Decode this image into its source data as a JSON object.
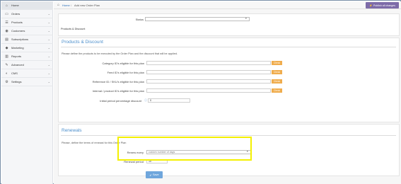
{
  "sidebar": {
    "items": [
      {
        "icon": "home-icon",
        "glyph": "⌂",
        "label": "Home",
        "has_chevron": false
      },
      {
        "icon": "cart-icon",
        "glyph": "🛒",
        "label": "Orders",
        "has_chevron": true
      },
      {
        "icon": "list-icon",
        "glyph": "☰",
        "label": "Products",
        "has_chevron": true
      },
      {
        "icon": "users-icon",
        "glyph": "👥",
        "label": "Customers",
        "has_chevron": true
      },
      {
        "icon": "subscriptions-icon",
        "glyph": "▤",
        "label": "Subscriptions",
        "has_chevron": true
      },
      {
        "icon": "tag-icon",
        "glyph": "🏷",
        "label": "Marketing",
        "has_chevron": true
      },
      {
        "icon": "chart-icon",
        "glyph": "▥",
        "label": "Reports",
        "has_chevron": true
      },
      {
        "icon": "wrench-icon",
        "glyph": "🔧",
        "label": "Advanced",
        "has_chevron": true
      },
      {
        "icon": "cms-icon",
        "glyph": "◐",
        "label": "CMS",
        "has_chevron": true
      },
      {
        "icon": "gear-icon",
        "glyph": "⚙",
        "label": "Settings",
        "has_chevron": true
      }
    ]
  },
  "breadcrumb": {
    "home": "Home",
    "separator": "/",
    "current": "Add new Order Plan"
  },
  "publish_button": {
    "label": "Publish all changes",
    "icon": "bolt-icon",
    "glyph": "⚡"
  },
  "status": {
    "label": "Status",
    "value": ""
  },
  "products_discount_small": "Products & Discount",
  "products_section": {
    "heading": "Products & Discount",
    "description": "Please define the products to be executed by the Order Plan and the discount that will be applied.",
    "fields": [
      {
        "label": "Category ID's eligible for this plan",
        "value": "",
        "button": "Check"
      },
      {
        "label": "Feed ID's eligible for this plan",
        "value": "",
        "button": "Check"
      },
      {
        "label": "Reference ID / SKU's eligible for this plan",
        "value": "",
        "button": "Check"
      },
      {
        "label": "Internal / product ID's eligible for this plan",
        "value": "",
        "button": "Check"
      }
    ],
    "discount": {
      "label": "Initial period percentage discount",
      "info_icon": "info-icon",
      "value": "0"
    }
  },
  "renewals_section": {
    "heading": "Renewals",
    "description": "Please, define the terms of renewal for this Order Plan",
    "renew_every": {
      "label": "Renew every",
      "value": "custom number of days"
    },
    "renewal_period": {
      "label": "Renewal period",
      "value": "10"
    }
  },
  "save_button": {
    "label": "Save",
    "icon": "check-icon"
  },
  "colors": {
    "accent": "#4d8fcc",
    "publish": "#7d6ba8",
    "check": "#f0ad4e",
    "highlight": "#f4f000",
    "save": "#6fa6dc"
  }
}
